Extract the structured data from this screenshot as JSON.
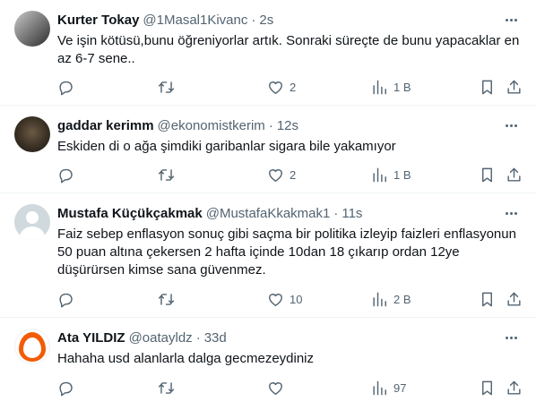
{
  "tweets": [
    {
      "name": "Kurter Tokay",
      "handle": "@1Masal1Kivanc",
      "dot": "·",
      "time": "2s",
      "text": "Ve işin kötüsü,bunu öğreniyorlar artık. Sonraki süreçte de bunu yapacaklar en az 6-7 sene..",
      "reply_count": "",
      "retweet_count": "",
      "like_count": "2",
      "view_count": "1 B",
      "avatar": "photo"
    },
    {
      "name": "gaddar kerimm",
      "handle": "@ekonomistkerim",
      "dot": "·",
      "time": "12s",
      "text": "Eskiden di o ağa şimdiki garibanlar sigara bile yakamıyor",
      "reply_count": "",
      "retweet_count": "",
      "like_count": "2",
      "view_count": "1 B",
      "avatar": "photo"
    },
    {
      "name": "Mustafa Küçükçakmak",
      "handle": "@MustafaKkakmak1",
      "dot": "·",
      "time": "11s",
      "text": "Faiz sebep enflasyon sonuç gibi saçma bir politika izleyip faizleri enflasyonun 50 puan altına çekersen 2 hafta içinde 10dan 18 çıkarıp ordan 12ye düşürürsen kimse sana güvenmez.",
      "reply_count": "",
      "retweet_count": "",
      "like_count": "10",
      "view_count": "2 B",
      "avatar": "default-silhouette"
    },
    {
      "name": "Ata YILDIZ",
      "handle": "@oatayldz",
      "dot": "·",
      "time": "33d",
      "text": "Hahaha usd alanlarla dalga gecmezeydiniz",
      "reply_count": "",
      "retweet_count": "",
      "like_count": "",
      "view_count": "97",
      "avatar": "orange-egg"
    }
  ],
  "icons": {
    "reply": "reply-icon",
    "retweet": "retweet-icon",
    "like": "heart-icon",
    "views": "views-chart-icon",
    "bookmark": "bookmark-icon",
    "share": "share-icon",
    "more": "more-options-icon"
  },
  "colors": {
    "text_primary": "#0f1419",
    "text_secondary": "#536471",
    "divider": "#eff3f4",
    "egg_avatar": "#f25c05"
  }
}
